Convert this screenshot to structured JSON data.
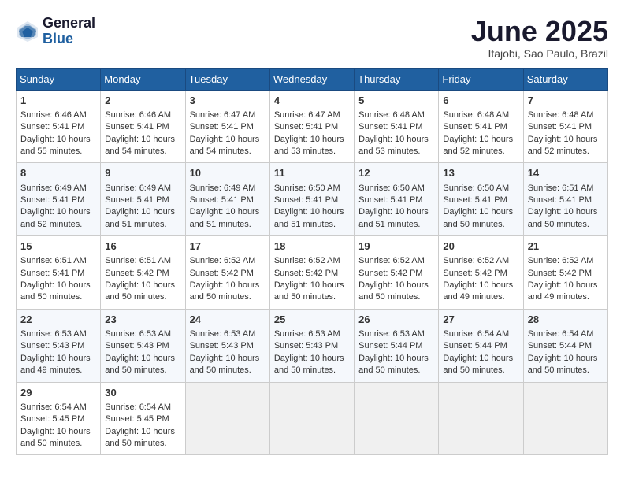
{
  "logo": {
    "general": "General",
    "blue": "Blue"
  },
  "title": "June 2025",
  "location": "Itajobi, Sao Paulo, Brazil",
  "days_header": [
    "Sunday",
    "Monday",
    "Tuesday",
    "Wednesday",
    "Thursday",
    "Friday",
    "Saturday"
  ],
  "weeks": [
    [
      {
        "day": "1",
        "sunrise": "Sunrise: 6:46 AM",
        "sunset": "Sunset: 5:41 PM",
        "daylight": "Daylight: 10 hours and 55 minutes."
      },
      {
        "day": "2",
        "sunrise": "Sunrise: 6:46 AM",
        "sunset": "Sunset: 5:41 PM",
        "daylight": "Daylight: 10 hours and 54 minutes."
      },
      {
        "day": "3",
        "sunrise": "Sunrise: 6:47 AM",
        "sunset": "Sunset: 5:41 PM",
        "daylight": "Daylight: 10 hours and 54 minutes."
      },
      {
        "day": "4",
        "sunrise": "Sunrise: 6:47 AM",
        "sunset": "Sunset: 5:41 PM",
        "daylight": "Daylight: 10 hours and 53 minutes."
      },
      {
        "day": "5",
        "sunrise": "Sunrise: 6:48 AM",
        "sunset": "Sunset: 5:41 PM",
        "daylight": "Daylight: 10 hours and 53 minutes."
      },
      {
        "day": "6",
        "sunrise": "Sunrise: 6:48 AM",
        "sunset": "Sunset: 5:41 PM",
        "daylight": "Daylight: 10 hours and 52 minutes."
      },
      {
        "day": "7",
        "sunrise": "Sunrise: 6:48 AM",
        "sunset": "Sunset: 5:41 PM",
        "daylight": "Daylight: 10 hours and 52 minutes."
      }
    ],
    [
      {
        "day": "8",
        "sunrise": "Sunrise: 6:49 AM",
        "sunset": "Sunset: 5:41 PM",
        "daylight": "Daylight: 10 hours and 52 minutes."
      },
      {
        "day": "9",
        "sunrise": "Sunrise: 6:49 AM",
        "sunset": "Sunset: 5:41 PM",
        "daylight": "Daylight: 10 hours and 51 minutes."
      },
      {
        "day": "10",
        "sunrise": "Sunrise: 6:49 AM",
        "sunset": "Sunset: 5:41 PM",
        "daylight": "Daylight: 10 hours and 51 minutes."
      },
      {
        "day": "11",
        "sunrise": "Sunrise: 6:50 AM",
        "sunset": "Sunset: 5:41 PM",
        "daylight": "Daylight: 10 hours and 51 minutes."
      },
      {
        "day": "12",
        "sunrise": "Sunrise: 6:50 AM",
        "sunset": "Sunset: 5:41 PM",
        "daylight": "Daylight: 10 hours and 51 minutes."
      },
      {
        "day": "13",
        "sunrise": "Sunrise: 6:50 AM",
        "sunset": "Sunset: 5:41 PM",
        "daylight": "Daylight: 10 hours and 50 minutes."
      },
      {
        "day": "14",
        "sunrise": "Sunrise: 6:51 AM",
        "sunset": "Sunset: 5:41 PM",
        "daylight": "Daylight: 10 hours and 50 minutes."
      }
    ],
    [
      {
        "day": "15",
        "sunrise": "Sunrise: 6:51 AM",
        "sunset": "Sunset: 5:41 PM",
        "daylight": "Daylight: 10 hours and 50 minutes."
      },
      {
        "day": "16",
        "sunrise": "Sunrise: 6:51 AM",
        "sunset": "Sunset: 5:42 PM",
        "daylight": "Daylight: 10 hours and 50 minutes."
      },
      {
        "day": "17",
        "sunrise": "Sunrise: 6:52 AM",
        "sunset": "Sunset: 5:42 PM",
        "daylight": "Daylight: 10 hours and 50 minutes."
      },
      {
        "day": "18",
        "sunrise": "Sunrise: 6:52 AM",
        "sunset": "Sunset: 5:42 PM",
        "daylight": "Daylight: 10 hours and 50 minutes."
      },
      {
        "day": "19",
        "sunrise": "Sunrise: 6:52 AM",
        "sunset": "Sunset: 5:42 PM",
        "daylight": "Daylight: 10 hours and 50 minutes."
      },
      {
        "day": "20",
        "sunrise": "Sunrise: 6:52 AM",
        "sunset": "Sunset: 5:42 PM",
        "daylight": "Daylight: 10 hours and 49 minutes."
      },
      {
        "day": "21",
        "sunrise": "Sunrise: 6:52 AM",
        "sunset": "Sunset: 5:42 PM",
        "daylight": "Daylight: 10 hours and 49 minutes."
      }
    ],
    [
      {
        "day": "22",
        "sunrise": "Sunrise: 6:53 AM",
        "sunset": "Sunset: 5:43 PM",
        "daylight": "Daylight: 10 hours and 49 minutes."
      },
      {
        "day": "23",
        "sunrise": "Sunrise: 6:53 AM",
        "sunset": "Sunset: 5:43 PM",
        "daylight": "Daylight: 10 hours and 50 minutes."
      },
      {
        "day": "24",
        "sunrise": "Sunrise: 6:53 AM",
        "sunset": "Sunset: 5:43 PM",
        "daylight": "Daylight: 10 hours and 50 minutes."
      },
      {
        "day": "25",
        "sunrise": "Sunrise: 6:53 AM",
        "sunset": "Sunset: 5:43 PM",
        "daylight": "Daylight: 10 hours and 50 minutes."
      },
      {
        "day": "26",
        "sunrise": "Sunrise: 6:53 AM",
        "sunset": "Sunset: 5:44 PM",
        "daylight": "Daylight: 10 hours and 50 minutes."
      },
      {
        "day": "27",
        "sunrise": "Sunrise: 6:54 AM",
        "sunset": "Sunset: 5:44 PM",
        "daylight": "Daylight: 10 hours and 50 minutes."
      },
      {
        "day": "28",
        "sunrise": "Sunrise: 6:54 AM",
        "sunset": "Sunset: 5:44 PM",
        "daylight": "Daylight: 10 hours and 50 minutes."
      }
    ],
    [
      {
        "day": "29",
        "sunrise": "Sunrise: 6:54 AM",
        "sunset": "Sunset: 5:45 PM",
        "daylight": "Daylight: 10 hours and 50 minutes."
      },
      {
        "day": "30",
        "sunrise": "Sunrise: 6:54 AM",
        "sunset": "Sunset: 5:45 PM",
        "daylight": "Daylight: 10 hours and 50 minutes."
      },
      null,
      null,
      null,
      null,
      null
    ]
  ]
}
